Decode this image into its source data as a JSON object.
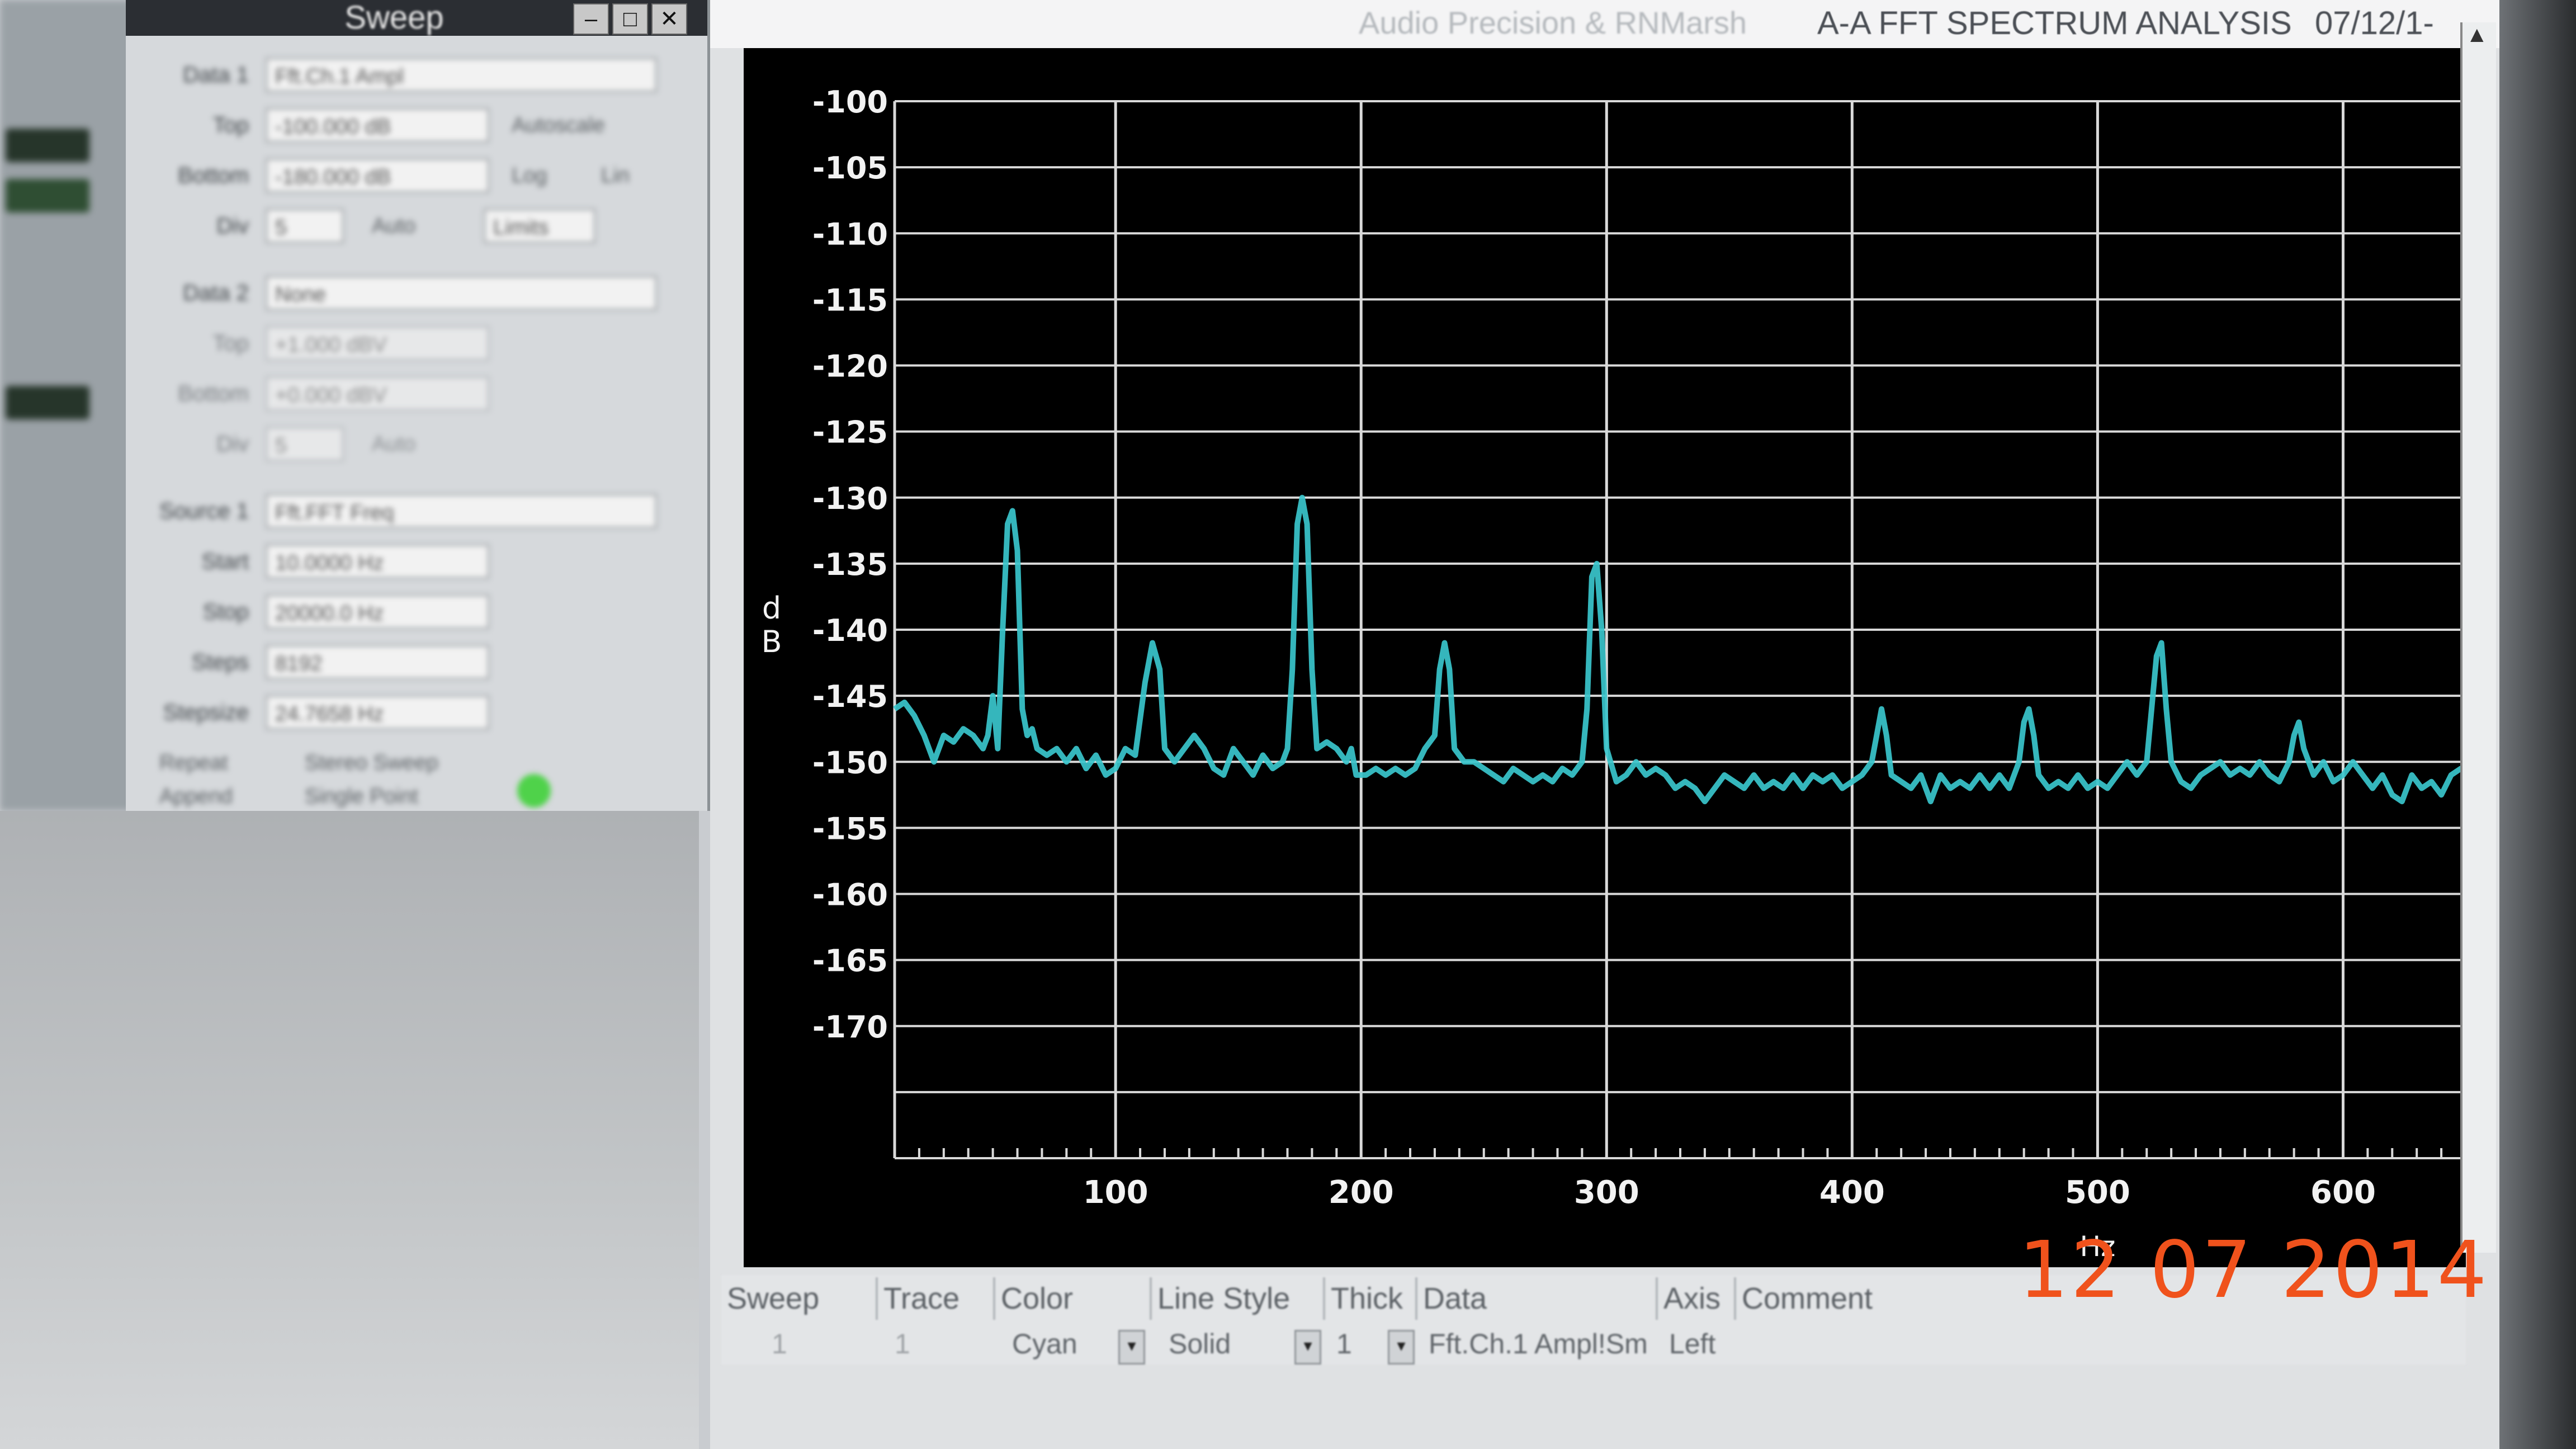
{
  "sweep_panel": {
    "title": "Sweep",
    "window_buttons": [
      "–",
      "□",
      "✕"
    ],
    "data1": {
      "label": "Data 1",
      "value": "Fft.Ch.1 Ampl"
    },
    "top": {
      "label": "Top",
      "value": "-100.000  dB",
      "option": "Autoscale"
    },
    "bottom": {
      "label": "Bottom",
      "value": "-180.000  dB",
      "options": [
        "Log",
        "Lin"
      ]
    },
    "div": {
      "label": "Div",
      "value": "5",
      "auto_label": "Auto",
      "limits_label": "Limits"
    },
    "data2": {
      "label": "Data 2",
      "value": "None"
    },
    "top2": {
      "label": "Top",
      "value": "+1.000  dBV"
    },
    "bottom2": {
      "label": "Bottom",
      "value": "+0.000  dBV"
    },
    "div2": {
      "label": "Div",
      "value": "5",
      "auto_label": "Auto"
    },
    "source1": {
      "label": "Source 1",
      "value": "Fft.FFT Freq"
    },
    "start": {
      "label": "Start",
      "value": "10.0000  Hz"
    },
    "stop": {
      "label": "Stop",
      "value": "20000.0  Hz"
    },
    "steps": {
      "label": "Steps",
      "value": "8192"
    },
    "stepsize": {
      "label": "Stepsize",
      "value": "24.7658  Hz"
    },
    "checks": [
      "Repeat",
      "Append",
      "Stereo Sweep",
      "Single Point"
    ]
  },
  "fft_window": {
    "title_left": "Audio Precision & RNMarsh",
    "title_right": "A-A FFT SPECTRUM ANALYSIS",
    "title_date": "07/12/1-",
    "y_axis_label_top": "d",
    "y_axis_label_bottom": "B",
    "x_unit_label": "Hz"
  },
  "chart_data": {
    "type": "line",
    "title": "A-A FFT SPECTRUM ANALYSIS",
    "xlabel": "Hz",
    "ylabel": "dB",
    "xlim": [
      10,
      650
    ],
    "ylim": [
      -180,
      -100
    ],
    "x_ticks": [
      100,
      200,
      300,
      400,
      500,
      600
    ],
    "y_ticks": [
      -100,
      -105,
      -110,
      -115,
      -120,
      -125,
      -130,
      -135,
      -140,
      -145,
      -150,
      -155,
      -160,
      -165,
      -170,
      -175,
      -180
    ],
    "y_tick_labels": [
      "-100",
      "-105",
      "-110",
      "-115",
      "-120",
      "-125",
      "-130",
      "-135",
      "-140",
      "-145",
      "-150",
      "-155",
      "-160",
      "-165",
      "-170",
      "",
      ""
    ],
    "grid": true,
    "series": [
      {
        "color": "#39c6cc",
        "points": [
          [
            10,
            -146
          ],
          [
            14,
            -145.5
          ],
          [
            18,
            -146.5
          ],
          [
            22,
            -148
          ],
          [
            26,
            -150
          ],
          [
            30,
            -148
          ],
          [
            34,
            -148.5
          ],
          [
            38,
            -147.5
          ],
          [
            42,
            -148
          ],
          [
            46,
            -149
          ],
          [
            48,
            -148
          ],
          [
            50,
            -145
          ],
          [
            52,
            -149
          ],
          [
            54,
            -140
          ],
          [
            56,
            -132
          ],
          [
            58,
            -131
          ],
          [
            60,
            -134
          ],
          [
            62,
            -146
          ],
          [
            64,
            -148
          ],
          [
            66,
            -147.5
          ],
          [
            68,
            -149
          ],
          [
            72,
            -149.5
          ],
          [
            76,
            -149
          ],
          [
            80,
            -150
          ],
          [
            84,
            -149
          ],
          [
            88,
            -150.5
          ],
          [
            92,
            -149.5
          ],
          [
            96,
            -151
          ],
          [
            100,
            -150.5
          ],
          [
            104,
            -149
          ],
          [
            108,
            -149.5
          ],
          [
            112,
            -144
          ],
          [
            115,
            -141
          ],
          [
            118,
            -143
          ],
          [
            120,
            -149
          ],
          [
            124,
            -150
          ],
          [
            128,
            -149
          ],
          [
            132,
            -148
          ],
          [
            136,
            -149
          ],
          [
            140,
            -150.5
          ],
          [
            144,
            -151
          ],
          [
            148,
            -149
          ],
          [
            152,
            -150
          ],
          [
            156,
            -151
          ],
          [
            160,
            -149.5
          ],
          [
            164,
            -150.5
          ],
          [
            168,
            -150
          ],
          [
            170,
            -149
          ],
          [
            172,
            -143
          ],
          [
            174,
            -132
          ],
          [
            176,
            -130
          ],
          [
            178,
            -132
          ],
          [
            180,
            -143
          ],
          [
            182,
            -149
          ],
          [
            186,
            -148.5
          ],
          [
            190,
            -149
          ],
          [
            194,
            -150
          ],
          [
            196,
            -149
          ],
          [
            198,
            -151
          ],
          [
            202,
            -151
          ],
          [
            206,
            -150.5
          ],
          [
            210,
            -151
          ],
          [
            214,
            -150.5
          ],
          [
            218,
            -151
          ],
          [
            222,
            -150.5
          ],
          [
            226,
            -149
          ],
          [
            230,
            -148
          ],
          [
            232,
            -143
          ],
          [
            234,
            -141
          ],
          [
            236,
            -143
          ],
          [
            238,
            -149
          ],
          [
            242,
            -150
          ],
          [
            246,
            -150
          ],
          [
            250,
            -150.5
          ],
          [
            254,
            -151
          ],
          [
            258,
            -151.5
          ],
          [
            262,
            -150.5
          ],
          [
            266,
            -151
          ],
          [
            270,
            -151.5
          ],
          [
            274,
            -151
          ],
          [
            278,
            -151.5
          ],
          [
            282,
            -150.5
          ],
          [
            286,
            -151
          ],
          [
            290,
            -150
          ],
          [
            292,
            -146
          ],
          [
            294,
            -136
          ],
          [
            296,
            -135
          ],
          [
            298,
            -140
          ],
          [
            300,
            -149
          ],
          [
            304,
            -151.5
          ],
          [
            308,
            -151
          ],
          [
            312,
            -150
          ],
          [
            316,
            -151
          ],
          [
            320,
            -150.5
          ],
          [
            324,
            -151
          ],
          [
            328,
            -152
          ],
          [
            332,
            -151.5
          ],
          [
            336,
            -152
          ],
          [
            340,
            -153
          ],
          [
            344,
            -152
          ],
          [
            348,
            -151
          ],
          [
            352,
            -151.5
          ],
          [
            356,
            -152
          ],
          [
            360,
            -151
          ],
          [
            364,
            -152
          ],
          [
            368,
            -151.5
          ],
          [
            372,
            -152
          ],
          [
            376,
            -151
          ],
          [
            380,
            -152
          ],
          [
            384,
            -151
          ],
          [
            388,
            -151.5
          ],
          [
            392,
            -151
          ],
          [
            396,
            -152
          ],
          [
            400,
            -151.5
          ],
          [
            404,
            -151
          ],
          [
            408,
            -150
          ],
          [
            410,
            -148
          ],
          [
            412,
            -146
          ],
          [
            414,
            -148
          ],
          [
            416,
            -151
          ],
          [
            420,
            -151.5
          ],
          [
            424,
            -152
          ],
          [
            428,
            -151
          ],
          [
            432,
            -153
          ],
          [
            436,
            -151
          ],
          [
            440,
            -152
          ],
          [
            444,
            -151.5
          ],
          [
            448,
            -152
          ],
          [
            452,
            -151
          ],
          [
            456,
            -152
          ],
          [
            460,
            -151
          ],
          [
            464,
            -152
          ],
          [
            468,
            -150
          ],
          [
            470,
            -147
          ],
          [
            472,
            -146
          ],
          [
            474,
            -148
          ],
          [
            476,
            -151
          ],
          [
            480,
            -152
          ],
          [
            484,
            -151.5
          ],
          [
            488,
            -152
          ],
          [
            492,
            -151
          ],
          [
            496,
            -152
          ],
          [
            500,
            -151.5
          ],
          [
            504,
            -152
          ],
          [
            508,
            -151
          ],
          [
            512,
            -150
          ],
          [
            516,
            -151
          ],
          [
            520,
            -150
          ],
          [
            522,
            -146
          ],
          [
            524,
            -142
          ],
          [
            526,
            -141
          ],
          [
            528,
            -146
          ],
          [
            530,
            -150
          ],
          [
            534,
            -151.5
          ],
          [
            538,
            -152
          ],
          [
            542,
            -151
          ],
          [
            546,
            -150.5
          ],
          [
            550,
            -150
          ],
          [
            554,
            -151
          ],
          [
            558,
            -150.5
          ],
          [
            562,
            -151
          ],
          [
            566,
            -150
          ],
          [
            570,
            -151
          ],
          [
            574,
            -151.5
          ],
          [
            578,
            -150
          ],
          [
            580,
            -148
          ],
          [
            582,
            -147
          ],
          [
            584,
            -149
          ],
          [
            588,
            -151
          ],
          [
            592,
            -150
          ],
          [
            596,
            -151.5
          ],
          [
            600,
            -151
          ],
          [
            604,
            -150
          ],
          [
            608,
            -151
          ],
          [
            612,
            -152
          ],
          [
            616,
            -151
          ],
          [
            620,
            -152.5
          ],
          [
            624,
            -153
          ],
          [
            628,
            -151
          ],
          [
            632,
            -152
          ],
          [
            636,
            -151.5
          ],
          [
            640,
            -152.5
          ],
          [
            644,
            -151
          ],
          [
            648,
            -150.5
          ],
          [
            650,
            -151
          ]
        ]
      }
    ]
  },
  "trace_table": {
    "headers": [
      "Sweep",
      "Trace",
      "Color",
      "Line Style",
      "Thick",
      "Data",
      "Axis",
      "Comment"
    ],
    "row": {
      "sweep": "1",
      "trace": "1",
      "color": "Cyan",
      "line_style": "Solid",
      "thick": "1",
      "data": "Fft.Ch.1 Ampl!Sm",
      "axis": "Left",
      "comment": ""
    }
  },
  "camera_date_stamp": "12 07  2014"
}
